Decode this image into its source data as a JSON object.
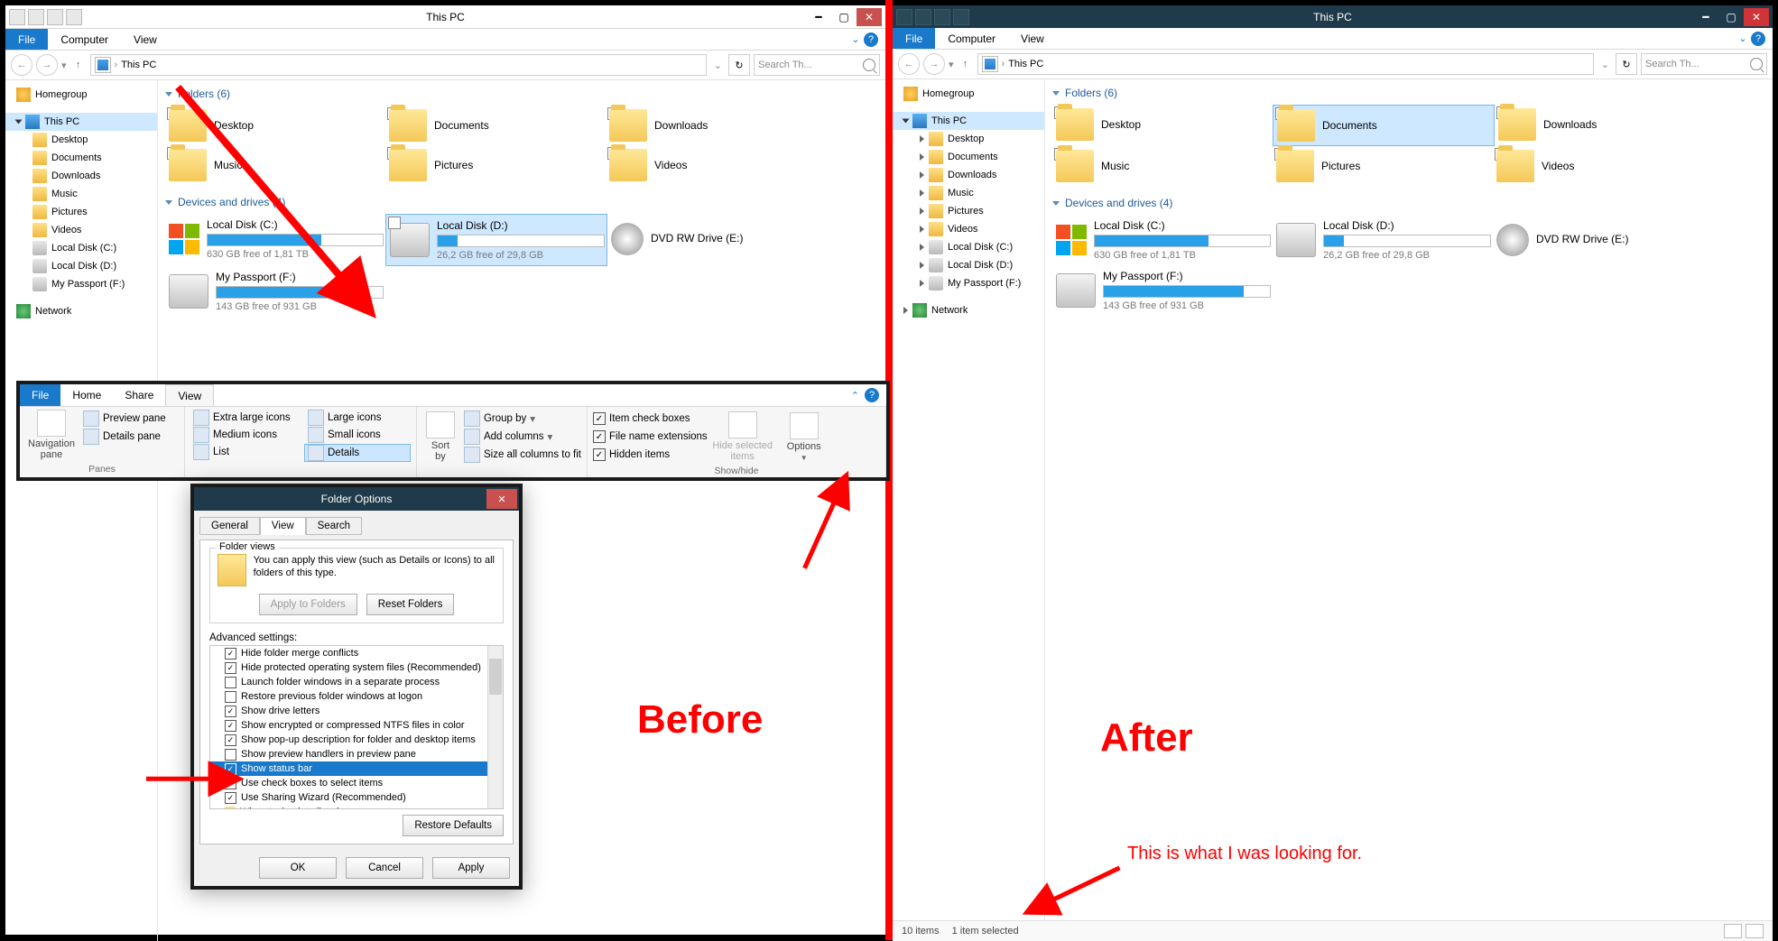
{
  "window": {
    "title": "This PC",
    "menubar": {
      "file": "File",
      "computer": "Computer",
      "view": "View"
    },
    "nav_back": "‹",
    "nav_fwd": "›",
    "nav_up": "↑",
    "address": "This PC",
    "search_placeholder": "Search Th..."
  },
  "navpane": {
    "homegroup": "Homegroup",
    "this_pc": "This PC",
    "children": [
      "Desktop",
      "Documents",
      "Downloads",
      "Music",
      "Pictures",
      "Videos",
      "Local Disk (C:)",
      "Local Disk (D:)",
      "My Passport (F:)"
    ],
    "network": "Network"
  },
  "folders_header": "Folders (6)",
  "folders": [
    "Desktop",
    "Documents",
    "Downloads",
    "Music",
    "Pictures",
    "Videos"
  ],
  "drives_header": "Devices and drives (4)",
  "drives": [
    {
      "name": "Local Disk (C:)",
      "sub": "630 GB free of 1,81 TB",
      "pct": 65,
      "kind": "win"
    },
    {
      "name": "Local Disk (D:)",
      "sub": "26,2 GB free of 29,8 GB",
      "pct": 12,
      "kind": "hdd"
    },
    {
      "name": "DVD RW Drive (E:)",
      "sub": "",
      "pct": null,
      "kind": "dvd"
    },
    {
      "name": "My Passport (F:)",
      "sub": "143 GB free of 931 GB",
      "pct": 84,
      "kind": "hdd"
    }
  ],
  "statusbar": {
    "items": "10 items",
    "selected": "1 item selected"
  },
  "ribbon": {
    "tabs": {
      "file": "File",
      "home": "Home",
      "share": "Share",
      "view": "View"
    },
    "panes": {
      "nav": "Navigation\npane",
      "preview": "Preview pane",
      "details": "Details pane",
      "group_label": "Panes"
    },
    "layout": {
      "xl": "Extra large icons",
      "l": "Large icons",
      "m": "Medium icons",
      "s": "Small icons",
      "list": "List",
      "details": "Details"
    },
    "view": {
      "sort": "Sort\nby",
      "group": "Group by",
      "addcol": "Add columns",
      "sizecol": "Size all columns to fit"
    },
    "showhide": {
      "chk": "Item check boxes",
      "ext": "File name extensions",
      "hidden": "Hidden items",
      "hidesel": "Hide selected\nitems",
      "options": "Options",
      "group_label": "Show/hide"
    }
  },
  "dialog": {
    "title": "Folder Options",
    "tabs": {
      "general": "General",
      "view": "View",
      "search": "Search"
    },
    "folder_views_legend": "Folder views",
    "fv_text": "You can apply this view (such as Details or Icons) to all folders of this type.",
    "apply_folders": "Apply to Folders",
    "reset_folders": "Reset Folders",
    "adv_label": "Advanced settings:",
    "adv": [
      {
        "t": "Hide folder merge conflicts",
        "c": true
      },
      {
        "t": "Hide protected operating system files (Recommended)",
        "c": true
      },
      {
        "t": "Launch folder windows in a separate process",
        "c": false
      },
      {
        "t": "Restore previous folder windows at logon",
        "c": false
      },
      {
        "t": "Show drive letters",
        "c": true
      },
      {
        "t": "Show encrypted or compressed NTFS files in color",
        "c": true
      },
      {
        "t": "Show pop-up description for folder and desktop items",
        "c": true
      },
      {
        "t": "Show preview handlers in preview pane",
        "c": false
      },
      {
        "t": "Show status bar",
        "c": true,
        "sel": true
      },
      {
        "t": "Use check boxes to select items",
        "c": true
      },
      {
        "t": "Use Sharing Wizard (Recommended)",
        "c": true
      },
      {
        "t": "When typing into list view",
        "c": null
      }
    ],
    "restore_defaults": "Restore Defaults",
    "ok": "OK",
    "cancel": "Cancel",
    "apply": "Apply"
  },
  "labels": {
    "before": "Before",
    "after": "After",
    "callout": "This is what I was looking for."
  }
}
